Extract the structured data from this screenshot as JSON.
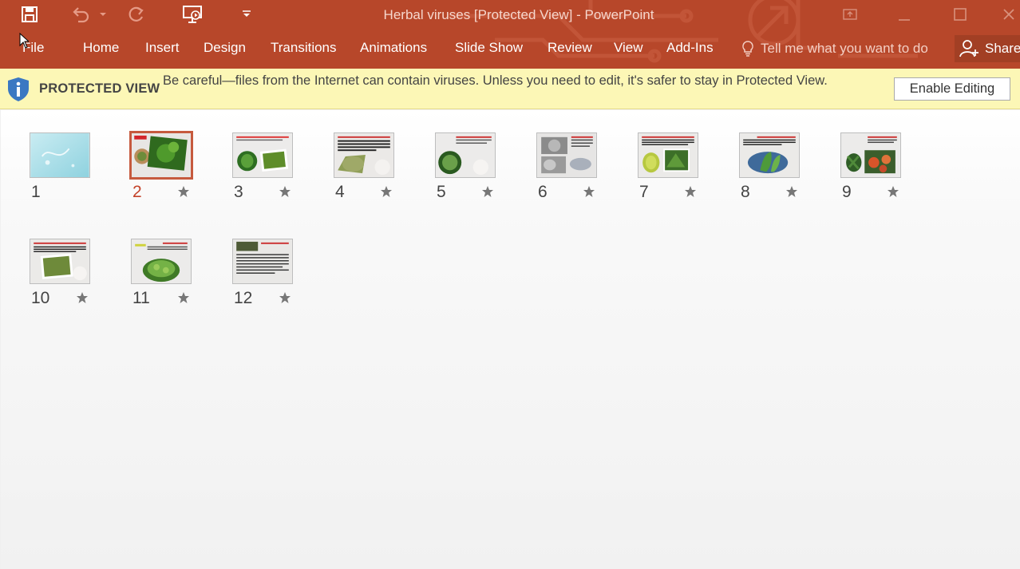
{
  "app": {
    "title": "Herbal viruses [Protected View] - PowerPoint"
  },
  "ribbon": {
    "tabs": [
      {
        "label": "File"
      },
      {
        "label": "Home"
      },
      {
        "label": "Insert"
      },
      {
        "label": "Design"
      },
      {
        "label": "Transitions"
      },
      {
        "label": "Animations"
      },
      {
        "label": "Slide Show"
      },
      {
        "label": "Review"
      },
      {
        "label": "View"
      },
      {
        "label": "Add-Ins"
      }
    ],
    "tell_me_placeholder": "Tell me what you want to do",
    "share_label": "Share"
  },
  "protected_view": {
    "label": "PROTECTED VIEW",
    "message": "Be careful—files from the Internet can contain viruses. Unless you need to edit, it's safer to stay in Protected View.",
    "button": "Enable Editing"
  },
  "slides": [
    {
      "number": "1",
      "has_animation": false,
      "selected": false
    },
    {
      "number": "2",
      "has_animation": true,
      "selected": true
    },
    {
      "number": "3",
      "has_animation": true,
      "selected": false
    },
    {
      "number": "4",
      "has_animation": true,
      "selected": false
    },
    {
      "number": "5",
      "has_animation": true,
      "selected": false
    },
    {
      "number": "6",
      "has_animation": true,
      "selected": false
    },
    {
      "number": "7",
      "has_animation": true,
      "selected": false
    },
    {
      "number": "8",
      "has_animation": true,
      "selected": false
    },
    {
      "number": "9",
      "has_animation": true,
      "selected": false
    },
    {
      "number": "10",
      "has_animation": true,
      "selected": false
    },
    {
      "number": "11",
      "has_animation": true,
      "selected": false
    },
    {
      "number": "12",
      "has_animation": true,
      "selected": false
    }
  ],
  "colors": {
    "accent": "#b7472a",
    "protected_bar": "#fcf7b6",
    "selection": "#c65a3e"
  }
}
